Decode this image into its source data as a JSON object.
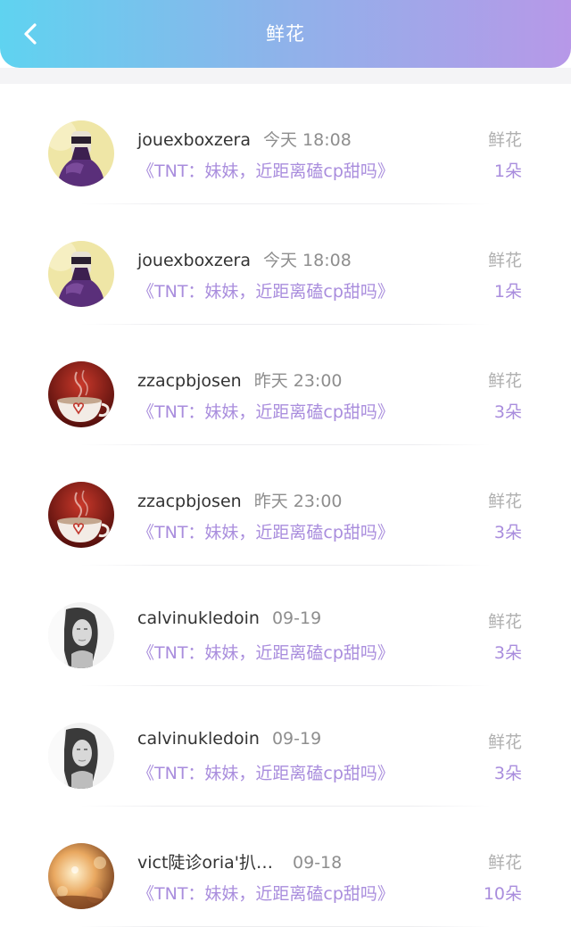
{
  "header": {
    "title": "鲜花",
    "back_icon": "chevron-left-icon"
  },
  "colors": {
    "header_gradient_start": "#5fd3f0",
    "header_gradient_end": "#b798e8",
    "accent_purple": "#a98ddd"
  },
  "records": [
    {
      "username": "jouexboxzera",
      "time": "今天 18:08",
      "book": "《TNT：妹妹，近距离磕cp甜吗》",
      "label": "鲜花",
      "count": "1朵",
      "avatar": "purple-hoodie-avatar"
    },
    {
      "username": "jouexboxzera",
      "time": "今天 18:08",
      "book": "《TNT：妹妹，近距离磕cp甜吗》",
      "label": "鲜花",
      "count": "1朵",
      "avatar": "purple-hoodie-avatar"
    },
    {
      "username": "zzacpbjosen",
      "time": "昨天 23:00",
      "book": "《TNT：妹妹，近距离磕cp甜吗》",
      "label": "鲜花",
      "count": "3朵",
      "avatar": "coffee-cup-avatar"
    },
    {
      "username": "zzacpbjosen",
      "time": "昨天 23:00",
      "book": "《TNT：妹妹，近距离磕cp甜吗》",
      "label": "鲜花",
      "count": "3朵",
      "avatar": "coffee-cup-avatar"
    },
    {
      "username": "calvinukledoin",
      "time": "09-19",
      "book": "《TNT：妹妹，近距离磕cp甜吗》",
      "label": "鲜花",
      "count": "3朵",
      "avatar": "grayscale-girl-avatar"
    },
    {
      "username": "calvinukledoin",
      "time": "09-19",
      "book": "《TNT：妹妹，近距离磕cp甜吗》",
      "label": "鲜花",
      "count": "3朵",
      "avatar": "grayscale-girl-avatar"
    },
    {
      "username": "vict陡诊oria'扒…",
      "time": "09-18",
      "book": "《TNT：妹妹，近距离磕cp甜吗》",
      "label": "鲜花",
      "count": "10朵",
      "avatar": "sunset-bokeh-avatar"
    }
  ]
}
